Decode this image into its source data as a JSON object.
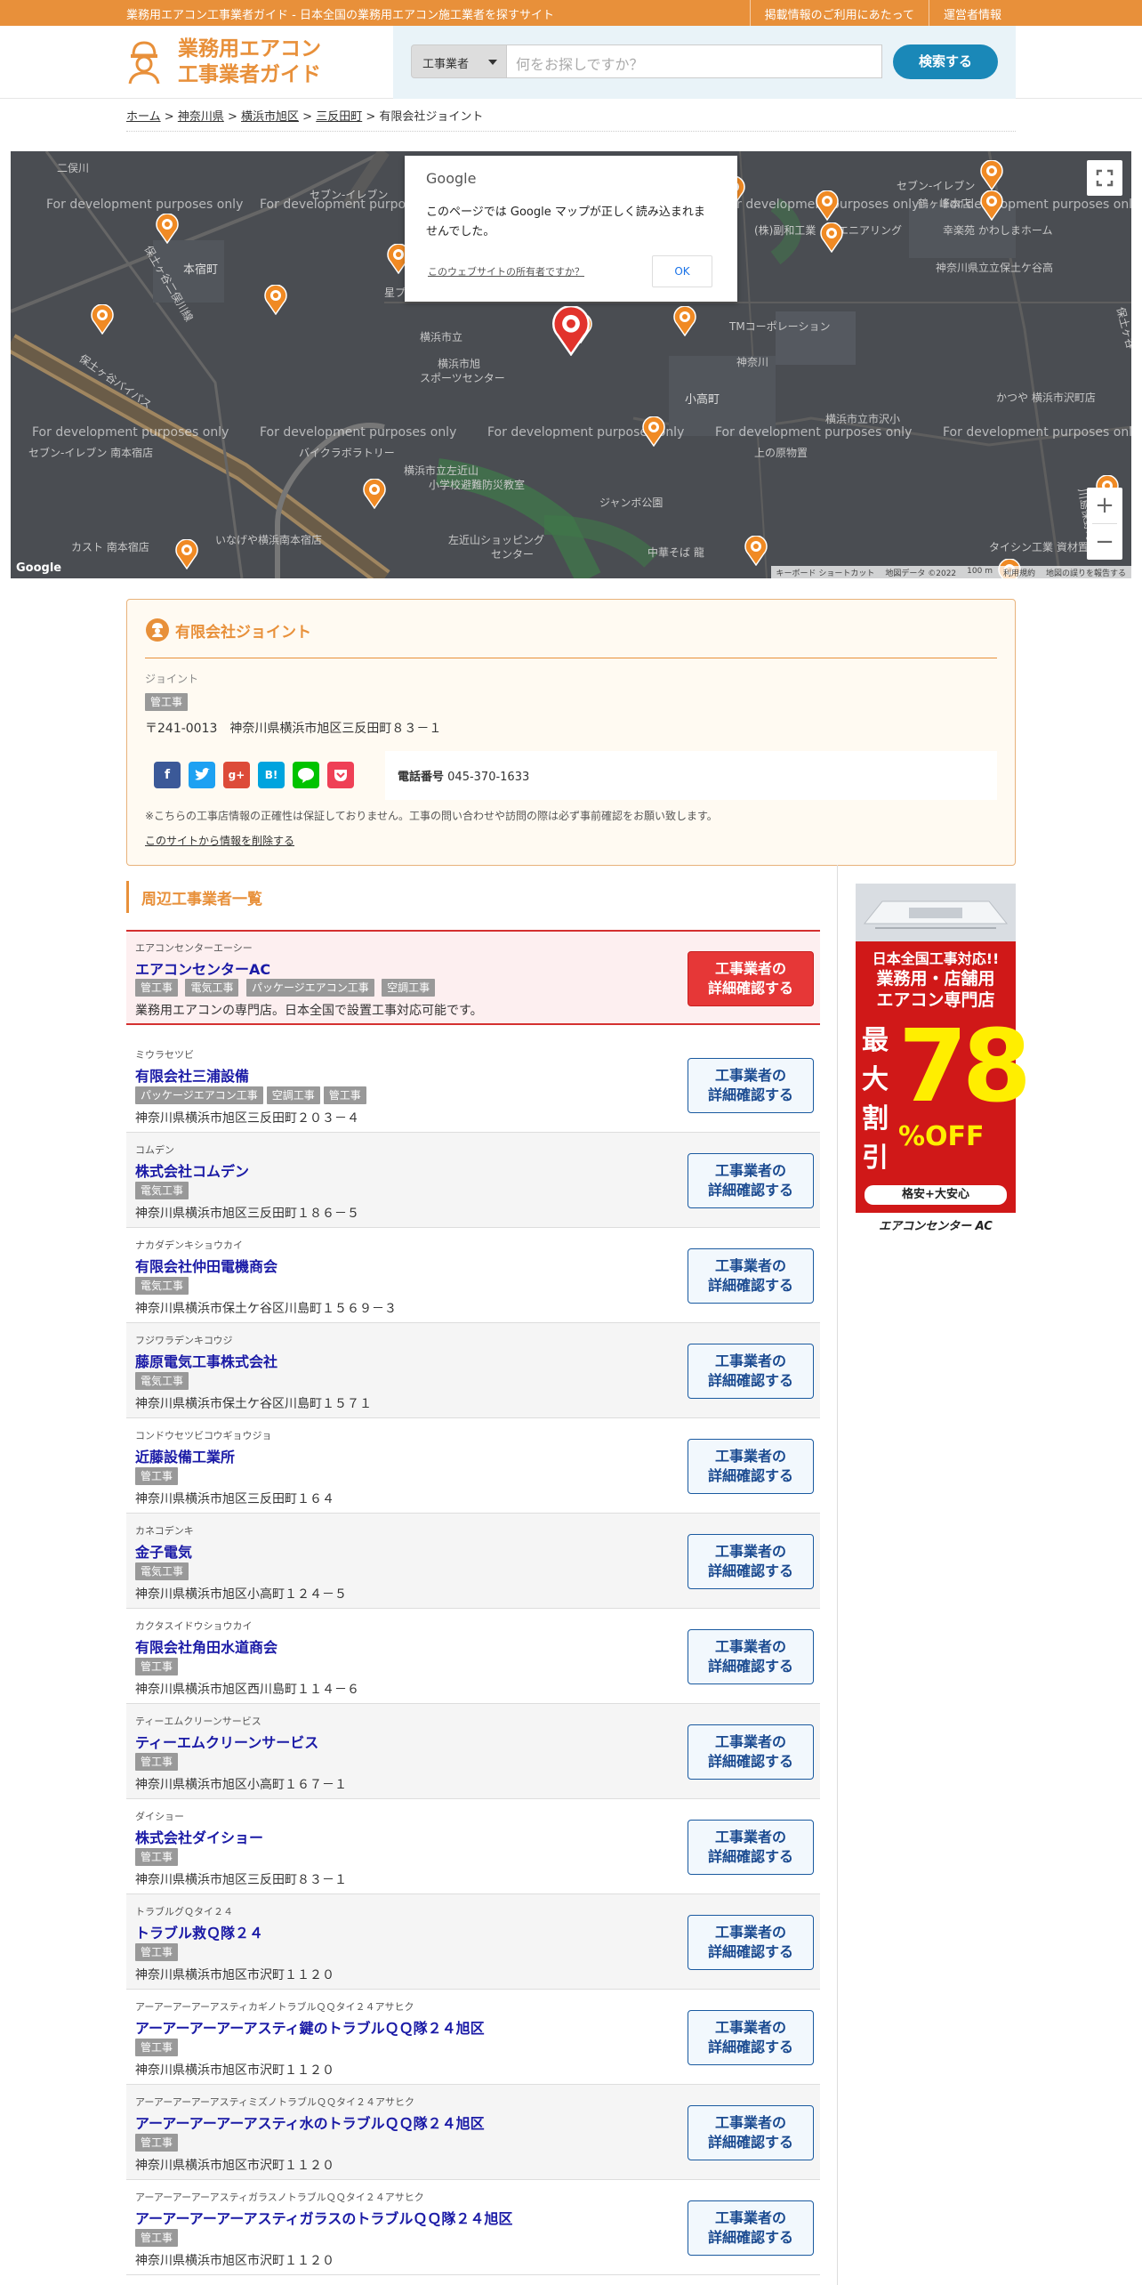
{
  "topbar": {
    "tagline": "業務用エアコン工事業者ガイド - 日本全国の業務用エアコン施工業者を探すサイト",
    "links": [
      "掲載情報のご利用にあたって",
      "運営者情報"
    ]
  },
  "header": {
    "logo_line1": "業務用エアコン",
    "logo_line2": "工事業者ガイド",
    "search_select": "工事業者",
    "search_placeholder": "何をお探しですか？",
    "search_button": "検索する"
  },
  "breadcrumb": {
    "items": [
      "ホーム",
      "神奈川県",
      "横浜市旭区",
      "三反田町"
    ],
    "current": "有限会社ジョイント",
    "separator": ">"
  },
  "map": {
    "dev_text": "For development purposes only",
    "dialog_logo": "Google",
    "dialog_message": "このページでは Google マップが正しく読み込まれませんでした。",
    "dialog_owner_link": "このウェブサイトの所有者ですか？",
    "dialog_ok": "OK",
    "zoom_in": "+",
    "zoom_out": "−",
    "google_logo": "Google",
    "footer": [
      "キーボード ショートカット",
      "地図データ ©2022",
      "100 m",
      "利用規約",
      "地図の誤りを報告する"
    ],
    "labels": {
      "l1": "二俣川",
      "l2": "セブン-イレブン",
      "l3": "本宿町",
      "l4": "保土ヶ谷二俣川線",
      "l5": "保土ヶ谷バイパス",
      "l6": "横浜市立",
      "l7": "横浜市旭",
      "l8": "スポーツセンター",
      "l9": "バイクラボラトリー",
      "l10": "セブン-イレブン 南本宿店",
      "l11": "カスト 南本宿店",
      "l12": "いなげや横浜南本宿店",
      "l13": "横浜市立左近山",
      "l14": "ジャンボ公園",
      "l15": "小高町",
      "l16": "TMコーポレーション",
      "l17": "神奈川",
      "l18": "神奈川県立立保土ケ谷高",
      "l19": "(株)副和工業",
      "l20": "セブン-イレブン",
      "l21": "幸楽苑 かわしまホーム",
      "l22": "エニアリング",
      "l23": "かつや 横浜市沢町店",
      "l24": "タイシン工業 資材置場",
      "l25": "中華そば 龍",
      "l26": "上の原物置",
      "l27": "横浜市立市沢小",
      "l28": "左近山ショッピング",
      "l29": "セブン-イレブン",
      "l30": "左近山",
      "l31": "センター",
      "l32": "小学校避難防災教室",
      "l33": "星プレイス(株)",
      "l34": "川島保野町",
      "l35": "鶴ヶ峰本店",
      "l36": "保土ヶ谷",
      "l37": "川島町"
    }
  },
  "business": {
    "name": "有限会社ジョイント",
    "kana": "ジョイント",
    "tag": "管工事",
    "address": "〒241-0013　神奈川県横浜市旭区三反田町８３－１",
    "phone_label": "電話番号",
    "phone": "045-370-1633",
    "note": "※こちらの工事店情報の正確性は保証しておりません。工事の問い合わせや訪問の際は必ず事前確認をお願い致します。",
    "delete_link": "このサイトから情報を削除する",
    "share_icons": [
      "facebook-icon",
      "twitter-icon",
      "googleplus-icon",
      "hatena-icon",
      "line-icon",
      "pocket-icon"
    ]
  },
  "nearby": {
    "heading": "周辺工事業者一覧",
    "button_line1": "工事業者の",
    "button_line2": "詳細確認する",
    "featured": {
      "kana": "エアコンセンターエーシー",
      "name": "エアコンセンターAC",
      "tags": [
        "管工事",
        "電気工事",
        "パッケージエアコン工事",
        "空調工事"
      ],
      "desc": "業務用エアコンの専門店。日本全国で設置工事対応可能です。"
    },
    "rows": [
      {
        "kana": "ミウラセツビ",
        "name": "有限会社三浦設備",
        "tags": [
          "パッケージエアコン工事",
          "空調工事",
          "管工事"
        ],
        "addr": "神奈川県横浜市旭区三反田町２０３－４"
      },
      {
        "kana": "コムデン",
        "name": "株式会社コムデン",
        "tags": [
          "電気工事"
        ],
        "addr": "神奈川県横浜市旭区三反田町１８６－５"
      },
      {
        "kana": "ナカダデンキショウカイ",
        "name": "有限会社仲田電機商会",
        "tags": [
          "電気工事"
        ],
        "addr": "神奈川県横浜市保土ケ谷区川島町１５６９－３"
      },
      {
        "kana": "フジワラデンキコウジ",
        "name": "藤原電気工事株式会社",
        "tags": [
          "電気工事"
        ],
        "addr": "神奈川県横浜市保土ケ谷区川島町１５７１"
      },
      {
        "kana": "コンドウセツビコウギョウジョ",
        "name": "近藤設備工業所",
        "tags": [
          "管工事"
        ],
        "addr": "神奈川県横浜市旭区三反田町１６４"
      },
      {
        "kana": "カネコデンキ",
        "name": "金子電気",
        "tags": [
          "電気工事"
        ],
        "addr": "神奈川県横浜市旭区小高町１２４－５"
      },
      {
        "kana": "カクタスイドウショウカイ",
        "name": "有限会社角田水道商会",
        "tags": [
          "管工事"
        ],
        "addr": "神奈川県横浜市旭区西川島町１１４－６"
      },
      {
        "kana": "ティーエムクリーンサービス",
        "name": "ティーエムクリーンサービス",
        "tags": [
          "管工事"
        ],
        "addr": "神奈川県横浜市旭区小高町１６７－１"
      },
      {
        "kana": "ダイショー",
        "name": "株式会社ダイショー",
        "tags": [
          "管工事"
        ],
        "addr": "神奈川県横浜市旭区三反田町８３－１"
      },
      {
        "kana": "トラブルグＱタイ２４",
        "name": "トラブル救Ｑ隊２４",
        "tags": [
          "管工事"
        ],
        "addr": "神奈川県横浜市旭区市沢町１１２０"
      },
      {
        "kana": "アーアーアーアーアスティカギノトラブルＱＱタイ２４アサヒク",
        "name": "アーアーアーアーアスティ鍵のトラブルＱＱ隊２４旭区",
        "tags": [
          "管工事"
        ],
        "addr": "神奈川県横浜市旭区市沢町１１２０"
      },
      {
        "kana": "アーアーアーアーアスティミズノトラブルＱＱタイ２４アサヒク",
        "name": "アーアーアーアーアスティ水のトラブルＱＱ隊２４旭区",
        "tags": [
          "管工事"
        ],
        "addr": "神奈川県横浜市旭区市沢町１１２０"
      },
      {
        "kana": "アーアーアーアーアスティガラスノトラブルＱＱタイ２４アサヒク",
        "name": "アーアーアーアーアスティガラスのトラブルＱＱ隊２４旭区",
        "tags": [
          "管工事"
        ],
        "addr": "神奈川県横浜市旭区市沢町１１２０"
      }
    ]
  },
  "ad": {
    "line1": "日本全国工事対応!!",
    "line2": "業務用・店舗用",
    "line3": "エアコン専門店",
    "side": "最大割引",
    "number": "78",
    "off": "%OFF",
    "slogan": "格安+大安心",
    "brand": "エアコンセンター AC"
  },
  "colors": {
    "accent": "#e8903a",
    "link": "#1a1aa6",
    "featured_red": "#e63737",
    "search_blue": "#1a88b8"
  }
}
